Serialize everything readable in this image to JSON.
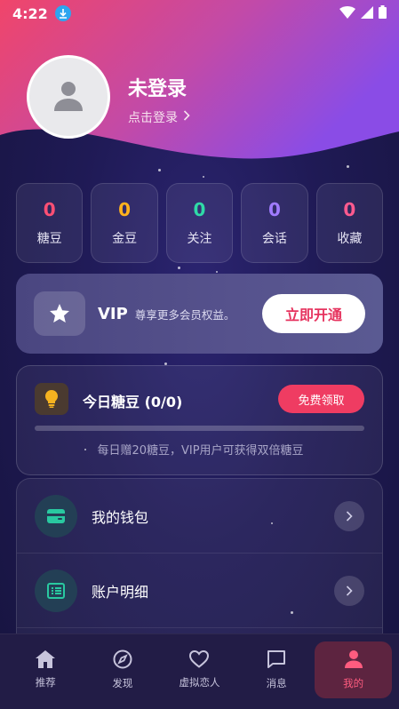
{
  "status_bar": {
    "time": "4:22"
  },
  "profile": {
    "name": "未登录",
    "login_link": "点击登录"
  },
  "stats": [
    {
      "value": "0",
      "label": "糖豆",
      "color": "#ff4f74"
    },
    {
      "value": "0",
      "label": "金豆",
      "color": "#ffb21d"
    },
    {
      "value": "0",
      "label": "关注",
      "color": "#2fd9a7"
    },
    {
      "value": "0",
      "label": "会话",
      "color": "#a07bff"
    },
    {
      "value": "0",
      "label": "收藏",
      "color": "#ff5a8f"
    }
  ],
  "vip": {
    "title": "VIP",
    "description": "尊享更多会员权益。",
    "button": "立即开通"
  },
  "daily_candy": {
    "title": "今日糖豆 (0/0)",
    "claim_button": "免费领取",
    "progress": 0,
    "note": "每日赠20糖豆，VIP用户可获得双倍糖豆"
  },
  "menu": [
    {
      "label": "我的钱包",
      "icon": "wallet-icon"
    },
    {
      "label": "账户明细",
      "icon": "list-icon"
    }
  ],
  "tabs": [
    {
      "label": "推荐",
      "icon": "home-icon"
    },
    {
      "label": "发现",
      "icon": "compass-icon"
    },
    {
      "label": "虚拟恋人",
      "icon": "heart-icon"
    },
    {
      "label": "消息",
      "icon": "message-icon"
    },
    {
      "label": "我的",
      "icon": "person-icon",
      "active": true
    }
  ],
  "colors": {
    "accent": "#ef3c62",
    "header_gradient_start": "#f0456a",
    "header_gradient_end": "#8a4ce6",
    "background": "#1f1a55"
  }
}
